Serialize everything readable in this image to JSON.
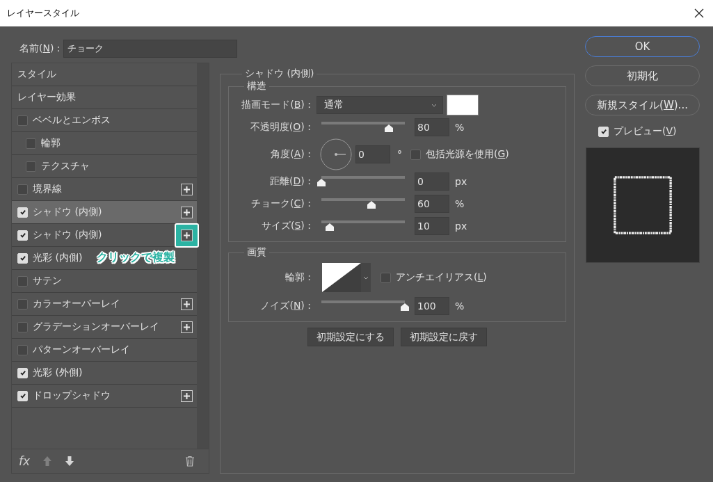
{
  "window": {
    "title": "レイヤースタイル"
  },
  "name_field": {
    "label": {
      "pre": "名前(",
      "key": "N",
      "post": ") :"
    },
    "value": "チョーク"
  },
  "effects": [
    {
      "kind": "header",
      "label": "スタイル",
      "selected": false,
      "addable": false
    },
    {
      "kind": "header",
      "label": "レイヤー効果",
      "selected": false,
      "addable": false
    },
    {
      "kind": "effect",
      "label": "ベベルとエンボス",
      "checked": false,
      "selected": false,
      "addable": false,
      "children": [
        {
          "kind": "effect",
          "label": "輪郭",
          "checked": false,
          "selected": false,
          "addable": false
        },
        {
          "kind": "effect",
          "label": "テクスチャ",
          "checked": false,
          "selected": false,
          "addable": false
        }
      ]
    },
    {
      "kind": "effect",
      "label": "境界線",
      "checked": false,
      "selected": false,
      "addable": true,
      "highlighted": false
    },
    {
      "kind": "effect",
      "label": "シャドウ (内側)",
      "checked": true,
      "selected": true,
      "addable": true,
      "highlighted": false
    },
    {
      "kind": "effect",
      "label": "シャドウ (内側)",
      "checked": true,
      "selected": false,
      "addable": true,
      "highlighted": true
    },
    {
      "kind": "effect",
      "label": "光彩 (内側)",
      "checked": true,
      "selected": false,
      "addable": false,
      "callout": "クリックで複製"
    },
    {
      "kind": "effect",
      "label": "サテン",
      "checked": false,
      "selected": false,
      "addable": false
    },
    {
      "kind": "effect",
      "label": "カラーオーバーレイ",
      "checked": false,
      "selected": false,
      "addable": true,
      "highlighted": false
    },
    {
      "kind": "effect",
      "label": "グラデーションオーバーレイ",
      "checked": false,
      "selected": false,
      "addable": true,
      "highlighted": false
    },
    {
      "kind": "effect",
      "label": "パターンオーバーレイ",
      "checked": false,
      "selected": false,
      "addable": false
    },
    {
      "kind": "effect",
      "label": "光彩 (外側)",
      "checked": true,
      "selected": false,
      "addable": false
    },
    {
      "kind": "effect",
      "label": "ドロップシャドウ",
      "checked": true,
      "selected": false,
      "addable": true,
      "highlighted": false
    }
  ],
  "list_toolbar": {
    "fx": "fx",
    "move_up_disabled": true,
    "move_down_disabled": false
  },
  "panel": {
    "title": "シャドウ (内側)",
    "structure": {
      "title": "構造",
      "rows": [
        {
          "kind": "dropdown",
          "label": {
            "pre": "描画モード(",
            "key": "B",
            "post": ") :"
          },
          "value": "通常",
          "color": "#ffffff"
        },
        {
          "kind": "slider",
          "label": {
            "pre": "不透明度(",
            "key": "O",
            "post": ") :"
          },
          "level": 0.81,
          "value": "80",
          "unit": "%"
        },
        {
          "kind": "angle",
          "label": {
            "pre": "角度(",
            "key": "A",
            "post": ") :"
          },
          "value": "0",
          "unit": "°",
          "global_light": {
            "pre": "包括光源を使用(",
            "key": "G",
            "post": ")",
            "checked": false
          }
        },
        {
          "kind": "slider",
          "label": {
            "pre": "距離(",
            "key": "D",
            "post": ") :"
          },
          "level": 0.0,
          "value": "0",
          "unit": "px"
        },
        {
          "kind": "slider",
          "label": {
            "pre": "チョーク(",
            "key": "C",
            "post": ") :"
          },
          "level": 0.6,
          "value": "60",
          "unit": "%"
        },
        {
          "kind": "slider",
          "label": {
            "pre": "サイズ(",
            "key": "S",
            "post": ") :"
          },
          "level": 0.1,
          "value": "10",
          "unit": "px"
        }
      ]
    },
    "quality": {
      "title": "画質",
      "rows": [
        {
          "kind": "contour",
          "label": {
            "pre": "輪郭 :"
          },
          "anti_alias": {
            "pre": "アンチエイリアス(",
            "key": "L",
            "post": ")",
            "checked": false
          }
        },
        {
          "kind": "slider",
          "label": {
            "pre": "ノイズ(",
            "key": "N",
            "post": ") :"
          },
          "level": 1.0,
          "value": "100",
          "unit": "%"
        }
      ]
    },
    "buttons": [
      "初期設定にする",
      "初期設定に戻す"
    ]
  },
  "side_buttons": [
    {
      "pre": "OK",
      "primary": true
    },
    {
      "pre": "初期化",
      "primary": false
    },
    {
      "pre": "新規スタイル(",
      "key": "W",
      "post": ")...",
      "primary": false
    }
  ],
  "preview": {
    "pre": "プレビュー(",
    "key": "V",
    "post": ")",
    "checked": true
  }
}
